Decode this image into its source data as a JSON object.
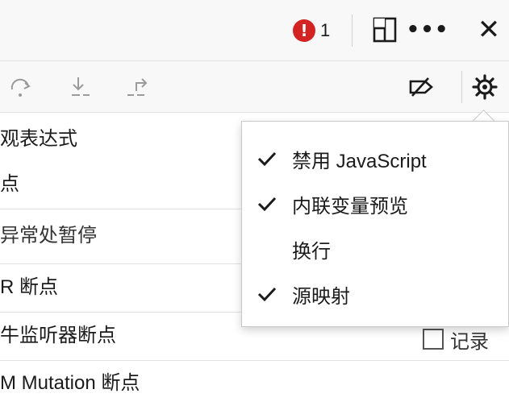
{
  "topbar": {
    "error_badge": "!",
    "error_count": "1",
    "more_label": "•••",
    "close_label": "✕"
  },
  "toolbar": {
    "icons": [
      "step-over-icon",
      "step-into-icon",
      "step-out-icon",
      "deactivate-breakpoints-icon",
      "settings-gear-icon"
    ]
  },
  "sections": [
    {
      "label": "观表达式"
    },
    {
      "label": "点"
    },
    {
      "label": "异常处暂停"
    },
    {
      "label": "R 断点"
    },
    {
      "label": "牛监听器断点",
      "record_label": "记录"
    },
    {
      "label": "M Mutation 断点"
    }
  ],
  "settings_menu": {
    "items": [
      {
        "label": "禁用 JavaScript",
        "checked": true
      },
      {
        "label": "内联变量预览",
        "checked": true
      },
      {
        "label": "换行",
        "checked": false
      },
      {
        "label": "源映射",
        "checked": true
      }
    ]
  },
  "colors": {
    "error": "#d32323",
    "icon_gray": "#9a9a9a",
    "icon_dark": "#1b1b1b"
  }
}
